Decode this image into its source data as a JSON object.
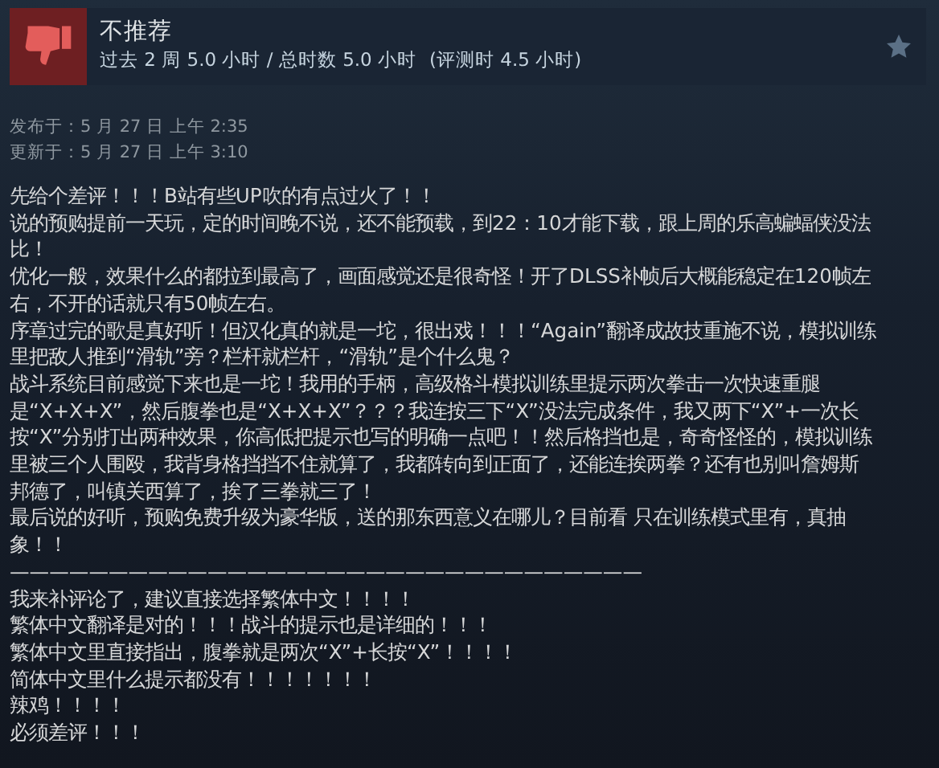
{
  "review": {
    "verdict": "不推荐",
    "recommended": false,
    "hours_recent": "过去 2 周 5.0 小时 / 总时数 5.0 小时",
    "hours_at_review": "(评测时 4.5 小时)"
  },
  "dates": [
    {
      "label": "发布于：",
      "value": "5 月 27 日 上午 2:35"
    },
    {
      "label": "更新于：",
      "value": "5 月 27 日 上午 3:10"
    }
  ],
  "body_lines": [
    "先给个差评！！！B站有些UP吹的有点过火了！！",
    "说的预购提前一天玩，定的时间晚不说，还不能预载，到22：10才能下载，跟上周的乐高蝙蝠侠没法",
    "比！",
    "优化一般，效果什么的都拉到最高了，画面感觉还是很奇怪！开了DLSS补帧后大概能稳定在120帧左",
    "右，不开的话就只有50帧左右。",
    "序章过完的歌是真好听！但汉化真的就是一坨，很出戏！！！“Again”翻译成故技重施不说，模拟训练",
    "里把敌人推到“滑轨”旁？栏杆就栏杆，“滑轨”是个什么鬼？",
    "战斗系统目前感觉下来也是一坨！我用的手柄，高级格斗模拟训练里提示两次拳击一次快速重腿",
    "是“X+X+X”，然后腹拳也是“X+X+X”？？？我连按三下“X”没法完成条件，我又两下“X”+一次长",
    "按“X”分别打出两种效果，你高低把提示也写的明确一点吧！！然后格挡也是，奇奇怪怪的，模拟训练",
    "里被三个人围殴，我背身格挡挡不住就算了，我都转向到正面了，还能连挨两拳？还有也别叫詹姆斯",
    "邦德了，叫镇关西算了，挨了三拳就三了！",
    "最后说的好听，预购免费升级为豪华版，送的那东西意义在哪儿？目前看 只在训练模式里有，真抽",
    "象！！",
    "————————————————————————————————",
    "我来补评论了，建议直接选择繁体中文！！！！",
    "繁体中文翻译是对的！！！战斗的提示也是详细的！！！",
    "繁体中文里直接指出，腹拳就是两次“X”+长按“X”！！！！",
    "简体中文里什么提示都没有！！！！！！！",
    "辣鸡！！！！",
    "必须差评！！！"
  ]
}
